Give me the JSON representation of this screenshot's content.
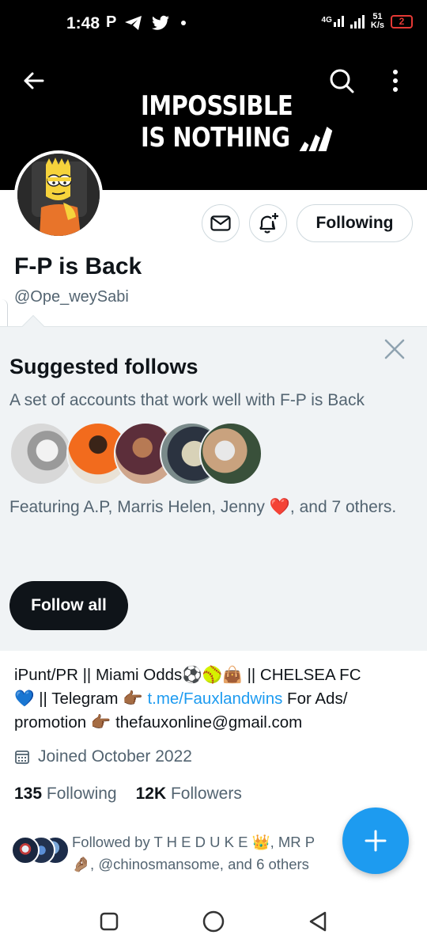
{
  "status_bar": {
    "time": "1:48",
    "p_label": "P",
    "net_type": "4G",
    "speed_value": "51",
    "speed_unit": "K/s",
    "battery": "2"
  },
  "header": {
    "back_icon": "arrow-left-icon",
    "search_icon": "search-icon",
    "more_icon": "more-vertical-icon",
    "banner_line1": "IMPOSSIBLE",
    "banner_line2": "IS NOTHING"
  },
  "profile": {
    "display_name": "F-P is Back",
    "handle": "@Ope_weySabi",
    "following_button": "Following",
    "bio_line1": "iPunt/PR || Miami Odds⚽🥎👜 || CHELSEA FC",
    "bio_line2_prefix": "💙 || Telegram 👉🏾 ",
    "bio_link": "t.me/Fauxlandwins",
    "bio_line2_suffix": "  For Ads/",
    "bio_line3": "promotion 👉🏾 thefauxonline@gmail.com",
    "joined": "Joined October 2022",
    "following_count": "135",
    "following_label": "Following",
    "followers_count": "12K",
    "followers_label": "Followers",
    "followed_by": "Followed by T H E D U K E 👑, MR P 🤌🏽, @chinosmansome, and 6 others"
  },
  "suggested": {
    "title": "Suggested follows",
    "subtitle": "A set of accounts that work well with F-P is Back",
    "featuring": "Featuring A.P, Marris Helen, Jenny ❤️, and 7 others.",
    "follow_all": "Follow all"
  },
  "colors": {
    "accent": "#1d9bf0",
    "text_primary": "#0f1419",
    "text_secondary": "#536471",
    "suggest_bg": "#f0f3f5"
  }
}
